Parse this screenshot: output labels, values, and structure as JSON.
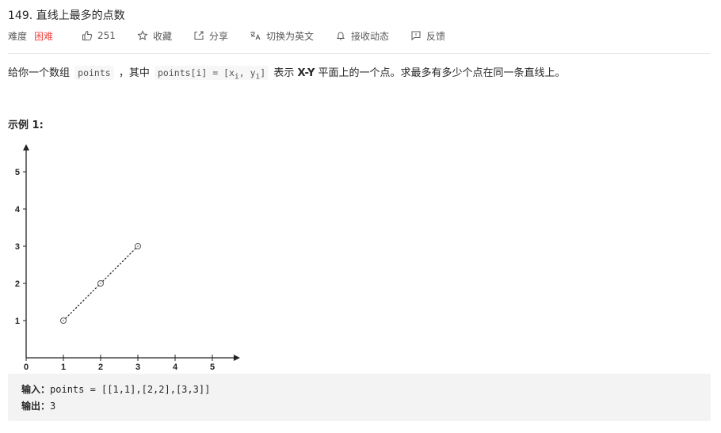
{
  "problem": {
    "title": "149. 直线上最多的点数",
    "difficulty_label": "难度",
    "difficulty": "困难",
    "difficulty_color": "#ef4743",
    "likes": "251",
    "actions": [
      {
        "icon": "star-icon",
        "label": "收藏"
      },
      {
        "icon": "share-icon",
        "label": "分享"
      },
      {
        "icon": "translate-icon",
        "label": "切换为英文"
      },
      {
        "icon": "bell-icon",
        "label": "接收动态"
      },
      {
        "icon": "feedback-icon",
        "label": "反馈"
      }
    ]
  },
  "description": {
    "part1": "给你一个数组",
    "code1": "points",
    "part2": "，其中",
    "code2_prefix": "points[i] = [x",
    "code2_sub1": "i",
    "code2_mid": ", y",
    "code2_sub2": "i",
    "code2_suffix": "]",
    "part3": "表示",
    "bold": "X-Y",
    "part4": "平面上的一个点。求最多有多少个点在同一条直线上。"
  },
  "example": {
    "title": "示例 1:",
    "input_label": "输入：",
    "input_value": "points = [[1,1],[2,2],[3,3]]",
    "output_label": "输出：",
    "output_value": "3"
  },
  "chart_data": {
    "type": "scatter",
    "title": "",
    "xlabel": "",
    "ylabel": "",
    "xlim": [
      0,
      5.7
    ],
    "ylim": [
      0,
      5.7
    ],
    "x_ticks": [
      0,
      1,
      2,
      3,
      4,
      5
    ],
    "y_ticks": [
      1,
      2,
      3,
      4,
      5
    ],
    "grid": false,
    "points": [
      {
        "x": 1,
        "y": 1
      },
      {
        "x": 2,
        "y": 2
      },
      {
        "x": 3,
        "y": 3
      }
    ],
    "line": {
      "style": "dotted",
      "from": {
        "x": 1,
        "y": 1
      },
      "to": {
        "x": 3,
        "y": 3
      }
    }
  }
}
